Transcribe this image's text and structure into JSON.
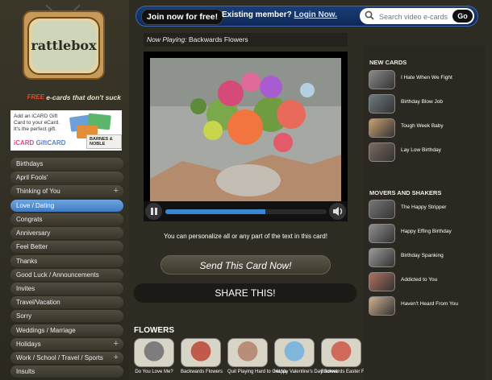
{
  "brand": {
    "logo_text": "rattlebox",
    "tagline": "e-cards that don't suck",
    "free": "FREE"
  },
  "gift_ad": {
    "text": "Add an iCARD Gift Card to your eCard. It's the perfect gift.",
    "brand_a": "iCARD",
    "brand_b": "GiftCARD",
    "partner": "BARNES & NOBLE"
  },
  "categories": [
    {
      "label": "Birthdays",
      "has_plus": false
    },
    {
      "label": "April Fools'",
      "has_plus": false
    },
    {
      "label": "Thinking of You",
      "has_plus": true
    },
    {
      "label": "Love / Dating",
      "has_plus": false,
      "active": true
    },
    {
      "label": "Congrats",
      "has_plus": false
    },
    {
      "label": "Anniversary",
      "has_plus": false
    },
    {
      "label": "Feel Better",
      "has_plus": false
    },
    {
      "label": "Thanks",
      "has_plus": false
    },
    {
      "label": "Good Luck / Announcements",
      "has_plus": false
    },
    {
      "label": "Invites",
      "has_plus": false
    },
    {
      "label": "Travel/Vacation",
      "has_plus": false
    },
    {
      "label": "Sorry",
      "has_plus": false
    },
    {
      "label": "Weddings / Marriage",
      "has_plus": false
    },
    {
      "label": "Holidays",
      "has_plus": true
    },
    {
      "label": "Work / School / Travel / Sports",
      "has_plus": true
    },
    {
      "label": "Insults",
      "has_plus": false
    }
  ],
  "topbar": {
    "join_label": "Join now for free!",
    "existing_label": "Existing member?",
    "login_label": "Login Now.",
    "search_placeholder": "Search video e-cards",
    "go_label": "Go"
  },
  "player": {
    "now_playing_label": "Now Playing:",
    "title": "Backwards Flowers",
    "progress": 0.62
  },
  "personalize_text": "You can personalize all or any part of the text in this card!",
  "send_label": "Send This Card Now!",
  "share_label": "SHARE THIS!",
  "flowers": {
    "title": "FLOWERS",
    "items": [
      {
        "caption": "Do You Love Me?",
        "color": "#7d7d7d"
      },
      {
        "caption": "Backwards Flowers",
        "color": "#c05a4a"
      },
      {
        "caption": "Quit Playing Hard to Get Va",
        "color": "#b98e78"
      },
      {
        "caption": "Happy Valentine's Day Sweet",
        "color": "#7fb6da"
      },
      {
        "caption": "Backwards Easter Flowers",
        "color": "#d06a5a"
      }
    ]
  },
  "new_cards": {
    "title": "NEW CARDS",
    "items": [
      {
        "label": "I Hate When We Fight",
        "color": "#8a8a8a"
      },
      {
        "label": "Birthday Blow Job",
        "color": "#6f7a80"
      },
      {
        "label": "Tough Week Baby",
        "color": "#c8a070"
      },
      {
        "label": "Lay Low Birthday",
        "color": "#7a6a60"
      }
    ]
  },
  "movers": {
    "title": "MOVERS AND SHAKERS",
    "items": [
      {
        "label": "The Happy Stripper",
        "color": "#777777"
      },
      {
        "label": "Happy Effing Birthday",
        "color": "#8f8f8f"
      },
      {
        "label": "Birthday Spanking",
        "color": "#9a9a9a"
      },
      {
        "label": "Addicted to You",
        "color": "#b07060"
      },
      {
        "label": "Haven't Heard From You",
        "color": "#d0b090"
      }
    ]
  }
}
